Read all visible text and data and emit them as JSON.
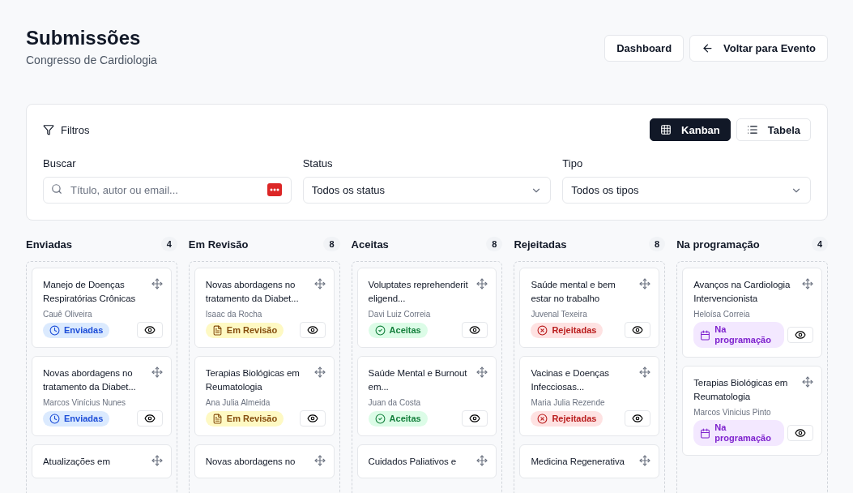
{
  "header": {
    "title": "Submissões",
    "subtitle": "Congresso de Cardiologia",
    "buttons": [
      {
        "kind": "plain",
        "label": "Dashboard"
      },
      {
        "kind": "back",
        "label": "Voltar para Evento"
      }
    ]
  },
  "filters": {
    "title": "Filtros",
    "views": [
      {
        "kind": "grid",
        "label": "Kanban",
        "selected": true
      },
      {
        "kind": "list",
        "label": "Tabela",
        "selected": false
      }
    ],
    "search": {
      "label": "Buscar",
      "placeholder": "Título, autor ou email..."
    },
    "selects": [
      {
        "label": "Status",
        "value": "Todos os status"
      },
      {
        "label": "Tipo",
        "value": "Todos os tipos"
      }
    ]
  },
  "columns": [
    {
      "title": "Enviadas",
      "count": "4",
      "kind": "sent",
      "cards": [
        {
          "title": "Manejo de Doenças Respiratórias Crônicas",
          "author": "Cauê Oliveira",
          "badge": "Enviadas"
        },
        {
          "title": "Novas abordagens no tratamento da Diabet...",
          "author": "Marcos Vinícius Nunes",
          "badge": "Enviadas"
        },
        {
          "title": "Atualizações em"
        }
      ]
    },
    {
      "title": "Em Revisão",
      "count": "8",
      "kind": "review",
      "cards": [
        {
          "title": "Novas abordagens no tratamento da Diabet...",
          "author": "Isaac da Rocha",
          "badge": "Em Revisão"
        },
        {
          "title": "Terapias Biológicas em Reumatologia",
          "author": "Ana Julia Almeida",
          "badge": "Em Revisão"
        },
        {
          "title": "Novas abordagens no"
        }
      ]
    },
    {
      "title": "Aceitas",
      "count": "8",
      "kind": "accepted",
      "cards": [
        {
          "title": "Voluptates reprehenderit eligend...",
          "author": "Davi Luiz Correia",
          "badge": "Aceitas"
        },
        {
          "title": "Saúde Mental e Burnout em...",
          "author": "Juan da Costa",
          "badge": "Aceitas"
        },
        {
          "title": "Cuidados Paliativos e"
        }
      ]
    },
    {
      "title": "Rejeitadas",
      "count": "8",
      "kind": "rejected",
      "cards": [
        {
          "title": "Saúde mental e bem estar no trabalho",
          "author": "Juvenal Texeira",
          "badge": "Rejeitadas"
        },
        {
          "title": "Vacinas e Doenças Infecciosas...",
          "author": "Maria Julia Rezende",
          "badge": "Rejeitadas"
        },
        {
          "title": "Medicina Regenerativa"
        }
      ]
    },
    {
      "title": "Na programação",
      "count": "4",
      "kind": "scheduled",
      "cards": [
        {
          "title": "Avanços na Cardiologia Intervencionista",
          "author": "Heloísa Correia",
          "badge": "Na programação"
        },
        {
          "title": "Terapias Biológicas em Reumatologia",
          "author": "Marcos Vinicius Pinto",
          "badge": "Na programação"
        }
      ]
    }
  ]
}
